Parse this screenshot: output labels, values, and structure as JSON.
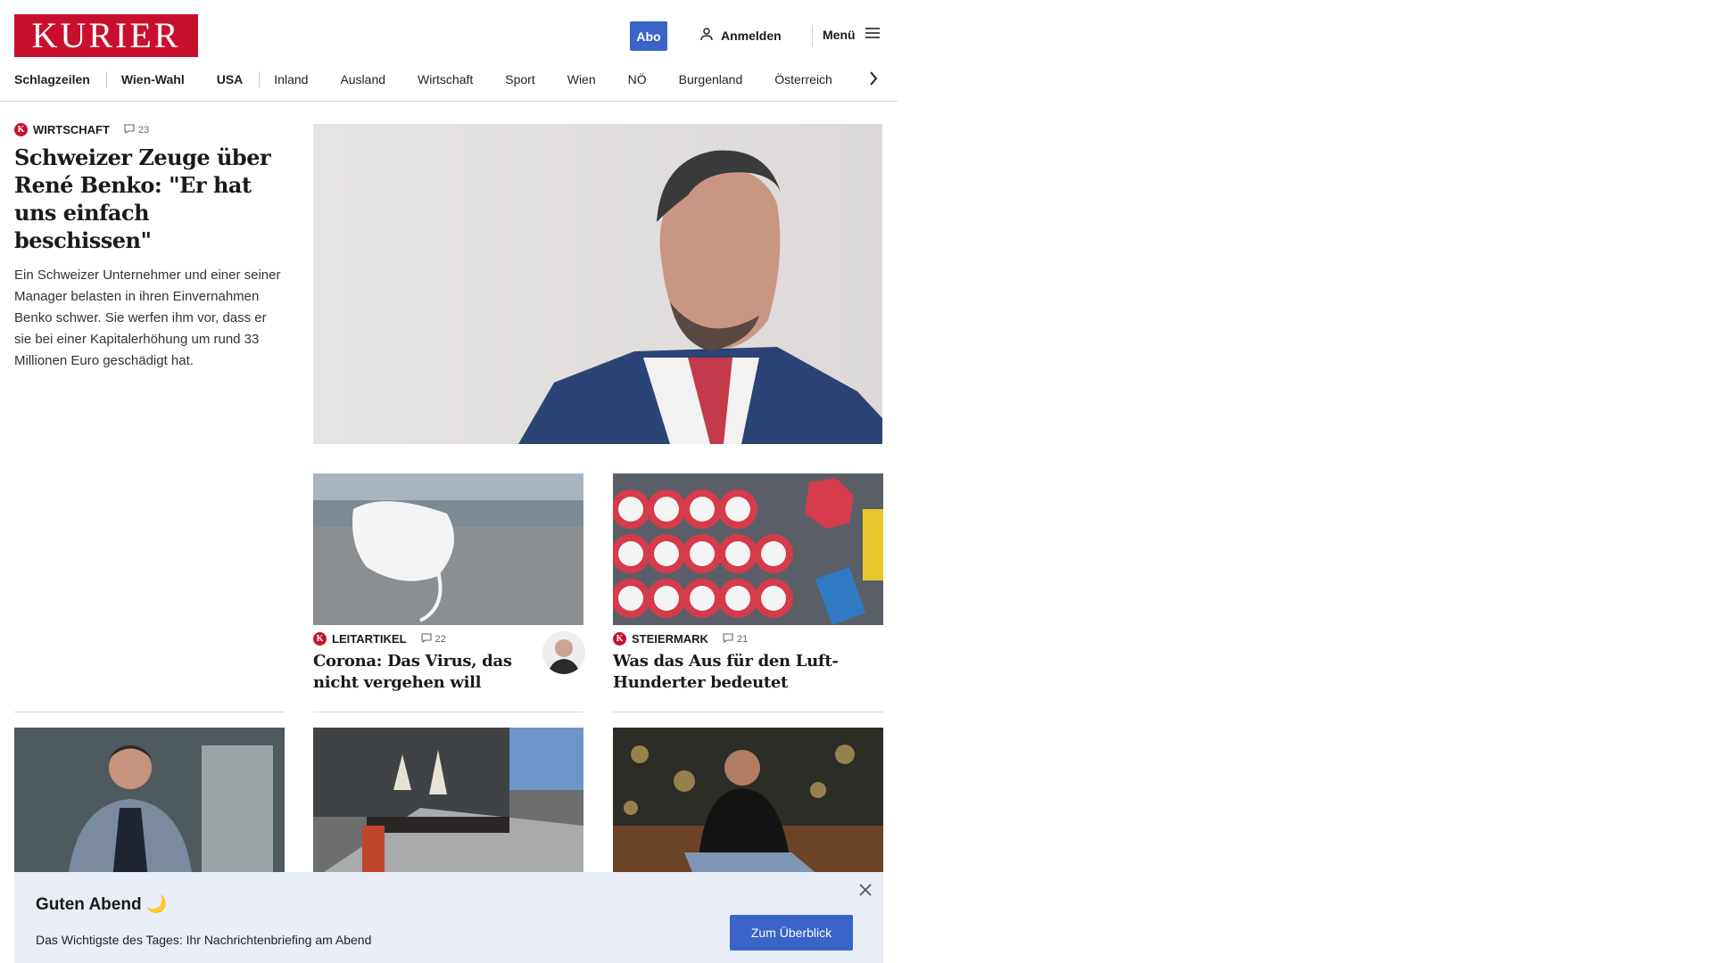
{
  "brand": {
    "logo_text": "KURIER",
    "color": "#c8102e"
  },
  "header": {
    "abo_label": "Abo",
    "login_label": "Anmelden",
    "menu_label": "Menü"
  },
  "nav": {
    "items": [
      "Schlagzeilen",
      "Wien-Wahl",
      "USA",
      "Inland",
      "Ausland",
      "Wirtschaft",
      "Sport",
      "Wien",
      "NÖ",
      "Burgenland",
      "Österreich"
    ]
  },
  "lead": {
    "kicker": "Wirtschaft",
    "comments": "23",
    "title": "Schweizer Zeuge über René Benko: \"Er hat uns einfach beschissen\"",
    "teaser": "Ein Schweizer Unternehmer und einer seiner Manager belasten in ihren Einvernahmen Benko schwer. Sie werfen ihm vor, dass er sie bei einer Kapitalerhöhung um rund 33 Millionen Euro geschädigt hat."
  },
  "cards": [
    {
      "kicker": "Leitartikel",
      "comments": "22",
      "title": "Corona: Das Virus, das nicht vergehen will"
    },
    {
      "kicker": "Steiermark",
      "comments": "21",
      "title": "Was das Aus für den Luft-Hunderter bedeutet"
    }
  ],
  "notification": {
    "title": "Guten Abend 🌙",
    "text": "Das Wichtigste des Tages: Ihr Nachrichtenbriefing am Abend",
    "button": "Zum Überblick"
  },
  "colors": {
    "accent": "#3a64c8",
    "brand_red": "#c8102e",
    "banner_bg": "#e9eef6"
  }
}
